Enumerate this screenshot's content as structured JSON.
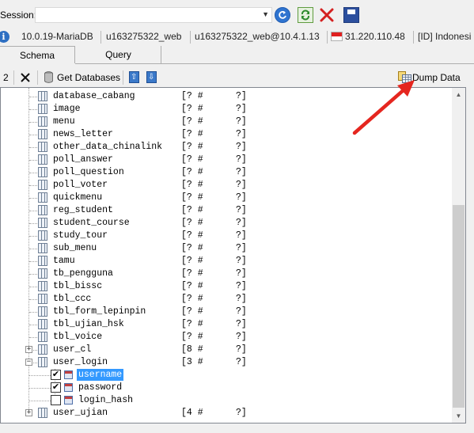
{
  "session": {
    "label": "Session:",
    "value": ""
  },
  "info": {
    "server_version": "10.0.19-MariaDB",
    "database": "u163275322_web",
    "user": "u163275322_web@10.4.1.13",
    "ip": "31.220.110.48",
    "location": "[ID] Indonesi"
  },
  "tabs": [
    {
      "label": "Schema"
    },
    {
      "label": "Query"
    }
  ],
  "toolbar": {
    "counter": "2",
    "get_databases": "Get Databases",
    "dump_data": "Dump Data"
  },
  "tables": [
    {
      "name": "database_cabang",
      "info": "[? #      ?]"
    },
    {
      "name": "image",
      "info": "[? #      ?]"
    },
    {
      "name": "menu",
      "info": "[? #      ?]"
    },
    {
      "name": "news_letter",
      "info": "[? #      ?]"
    },
    {
      "name": "other_data_chinalink",
      "info": "[? #      ?]"
    },
    {
      "name": "poll_answer",
      "info": "[? #      ?]"
    },
    {
      "name": "poll_question",
      "info": "[? #      ?]"
    },
    {
      "name": "poll_voter",
      "info": "[? #      ?]"
    },
    {
      "name": "quickmenu",
      "info": "[? #      ?]"
    },
    {
      "name": "reg_student",
      "info": "[? #      ?]"
    },
    {
      "name": "student_course",
      "info": "[? #      ?]"
    },
    {
      "name": "study_tour",
      "info": "[? #      ?]"
    },
    {
      "name": "sub_menu",
      "info": "[? #      ?]"
    },
    {
      "name": "tamu",
      "info": "[? #      ?]"
    },
    {
      "name": "tb_pengguna",
      "info": "[? #      ?]"
    },
    {
      "name": "tbl_bissc",
      "info": "[? #      ?]"
    },
    {
      "name": "tbl_ccc",
      "info": "[? #      ?]"
    },
    {
      "name": "tbl_form_lepinpin",
      "info": "[? #      ?]"
    },
    {
      "name": "tbl_ujian_hsk",
      "info": "[? #      ?]"
    },
    {
      "name": "tbl_voice",
      "info": "[? #      ?]"
    },
    {
      "name": "user_cl",
      "info": "[8 #      ?]",
      "expander": "+"
    },
    {
      "name": "user_login",
      "info": "[3 #      ?]",
      "expander": "−"
    }
  ],
  "columns": [
    {
      "name": "username",
      "checked": "✔",
      "selected": true
    },
    {
      "name": "password",
      "checked": "✔",
      "selected": false
    },
    {
      "name": "login_hash",
      "checked": "",
      "selected": false
    }
  ],
  "last_table": {
    "name": "user_ujian",
    "info": "[4 #      ?]",
    "expander": "+"
  },
  "colors": {
    "selection": "#3399ff",
    "annotation_arrow": "#e5261f"
  }
}
